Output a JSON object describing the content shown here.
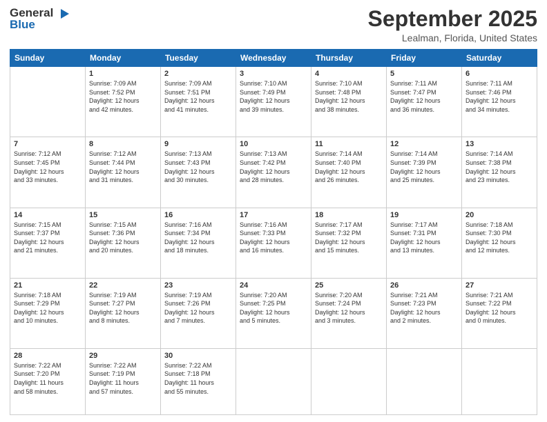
{
  "logo": {
    "line1": "General",
    "line2": "Blue"
  },
  "header": {
    "month": "September 2025",
    "location": "Lealman, Florida, United States"
  },
  "weekdays": [
    "Sunday",
    "Monday",
    "Tuesday",
    "Wednesday",
    "Thursday",
    "Friday",
    "Saturday"
  ],
  "weeks": [
    [
      {
        "day": "",
        "info": ""
      },
      {
        "day": "1",
        "info": "Sunrise: 7:09 AM\nSunset: 7:52 PM\nDaylight: 12 hours\nand 42 minutes."
      },
      {
        "day": "2",
        "info": "Sunrise: 7:09 AM\nSunset: 7:51 PM\nDaylight: 12 hours\nand 41 minutes."
      },
      {
        "day": "3",
        "info": "Sunrise: 7:10 AM\nSunset: 7:49 PM\nDaylight: 12 hours\nand 39 minutes."
      },
      {
        "day": "4",
        "info": "Sunrise: 7:10 AM\nSunset: 7:48 PM\nDaylight: 12 hours\nand 38 minutes."
      },
      {
        "day": "5",
        "info": "Sunrise: 7:11 AM\nSunset: 7:47 PM\nDaylight: 12 hours\nand 36 minutes."
      },
      {
        "day": "6",
        "info": "Sunrise: 7:11 AM\nSunset: 7:46 PM\nDaylight: 12 hours\nand 34 minutes."
      }
    ],
    [
      {
        "day": "7",
        "info": "Sunrise: 7:12 AM\nSunset: 7:45 PM\nDaylight: 12 hours\nand 33 minutes."
      },
      {
        "day": "8",
        "info": "Sunrise: 7:12 AM\nSunset: 7:44 PM\nDaylight: 12 hours\nand 31 minutes."
      },
      {
        "day": "9",
        "info": "Sunrise: 7:13 AM\nSunset: 7:43 PM\nDaylight: 12 hours\nand 30 minutes."
      },
      {
        "day": "10",
        "info": "Sunrise: 7:13 AM\nSunset: 7:42 PM\nDaylight: 12 hours\nand 28 minutes."
      },
      {
        "day": "11",
        "info": "Sunrise: 7:14 AM\nSunset: 7:40 PM\nDaylight: 12 hours\nand 26 minutes."
      },
      {
        "day": "12",
        "info": "Sunrise: 7:14 AM\nSunset: 7:39 PM\nDaylight: 12 hours\nand 25 minutes."
      },
      {
        "day": "13",
        "info": "Sunrise: 7:14 AM\nSunset: 7:38 PM\nDaylight: 12 hours\nand 23 minutes."
      }
    ],
    [
      {
        "day": "14",
        "info": "Sunrise: 7:15 AM\nSunset: 7:37 PM\nDaylight: 12 hours\nand 21 minutes."
      },
      {
        "day": "15",
        "info": "Sunrise: 7:15 AM\nSunset: 7:36 PM\nDaylight: 12 hours\nand 20 minutes."
      },
      {
        "day": "16",
        "info": "Sunrise: 7:16 AM\nSunset: 7:34 PM\nDaylight: 12 hours\nand 18 minutes."
      },
      {
        "day": "17",
        "info": "Sunrise: 7:16 AM\nSunset: 7:33 PM\nDaylight: 12 hours\nand 16 minutes."
      },
      {
        "day": "18",
        "info": "Sunrise: 7:17 AM\nSunset: 7:32 PM\nDaylight: 12 hours\nand 15 minutes."
      },
      {
        "day": "19",
        "info": "Sunrise: 7:17 AM\nSunset: 7:31 PM\nDaylight: 12 hours\nand 13 minutes."
      },
      {
        "day": "20",
        "info": "Sunrise: 7:18 AM\nSunset: 7:30 PM\nDaylight: 12 hours\nand 12 minutes."
      }
    ],
    [
      {
        "day": "21",
        "info": "Sunrise: 7:18 AM\nSunset: 7:29 PM\nDaylight: 12 hours\nand 10 minutes."
      },
      {
        "day": "22",
        "info": "Sunrise: 7:19 AM\nSunset: 7:27 PM\nDaylight: 12 hours\nand 8 minutes."
      },
      {
        "day": "23",
        "info": "Sunrise: 7:19 AM\nSunset: 7:26 PM\nDaylight: 12 hours\nand 7 minutes."
      },
      {
        "day": "24",
        "info": "Sunrise: 7:20 AM\nSunset: 7:25 PM\nDaylight: 12 hours\nand 5 minutes."
      },
      {
        "day": "25",
        "info": "Sunrise: 7:20 AM\nSunset: 7:24 PM\nDaylight: 12 hours\nand 3 minutes."
      },
      {
        "day": "26",
        "info": "Sunrise: 7:21 AM\nSunset: 7:23 PM\nDaylight: 12 hours\nand 2 minutes."
      },
      {
        "day": "27",
        "info": "Sunrise: 7:21 AM\nSunset: 7:22 PM\nDaylight: 12 hours\nand 0 minutes."
      }
    ],
    [
      {
        "day": "28",
        "info": "Sunrise: 7:22 AM\nSunset: 7:20 PM\nDaylight: 11 hours\nand 58 minutes."
      },
      {
        "day": "29",
        "info": "Sunrise: 7:22 AM\nSunset: 7:19 PM\nDaylight: 11 hours\nand 57 minutes."
      },
      {
        "day": "30",
        "info": "Sunrise: 7:22 AM\nSunset: 7:18 PM\nDaylight: 11 hours\nand 55 minutes."
      },
      {
        "day": "",
        "info": ""
      },
      {
        "day": "",
        "info": ""
      },
      {
        "day": "",
        "info": ""
      },
      {
        "day": "",
        "info": ""
      }
    ]
  ]
}
